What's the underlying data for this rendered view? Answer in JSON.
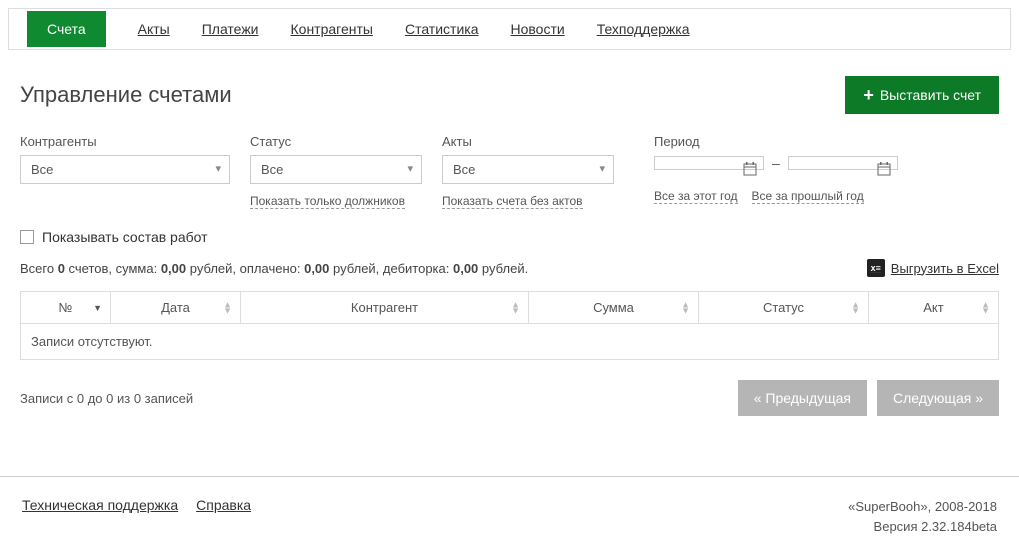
{
  "nav": {
    "items": [
      "Счета",
      "Акты",
      "Платежи",
      "Контрагенты",
      "Статистика",
      "Новости",
      "Техподдержка"
    ],
    "active": 0
  },
  "page_title": "Управление счетами",
  "primary_button": "Выставить счет",
  "filters": {
    "contractor": {
      "label": "Контрагенты",
      "value": "Все"
    },
    "status": {
      "label": "Статус",
      "value": "Все",
      "sublink": "Показать только должников"
    },
    "acts": {
      "label": "Акты",
      "value": "Все",
      "sublink": "Показать счета без актов"
    },
    "period": {
      "label": "Период",
      "link_year": "Все за этот год",
      "link_prev": "Все за прошлый год"
    }
  },
  "checkbox_label": "Показывать состав работ",
  "summary": {
    "prefix": "Всего ",
    "count": "0",
    "mid1": " счетов, сумма: ",
    "sum": "0,00",
    "mid2": " рублей, оплачено: ",
    "paid": "0,00",
    "mid3": " рублей, дебиторка: ",
    "debt": "0,00",
    "suffix": " рублей."
  },
  "excel_link": "Выгрузить в Excel",
  "table": {
    "headers": [
      "№",
      "Дата",
      "Контрагент",
      "Сумма",
      "Статус",
      "Акт"
    ],
    "empty": "Записи отсутствуют."
  },
  "pager": {
    "info": "Записи с 0 до 0 из 0 записей",
    "prev": "« Предыдущая",
    "next": "Следующая »"
  },
  "footer": {
    "tech": "Техническая поддержка",
    "help": "Справка",
    "brand": "«SuperBooh», 2008-2018",
    "version": "Версия 2.32.184beta"
  }
}
